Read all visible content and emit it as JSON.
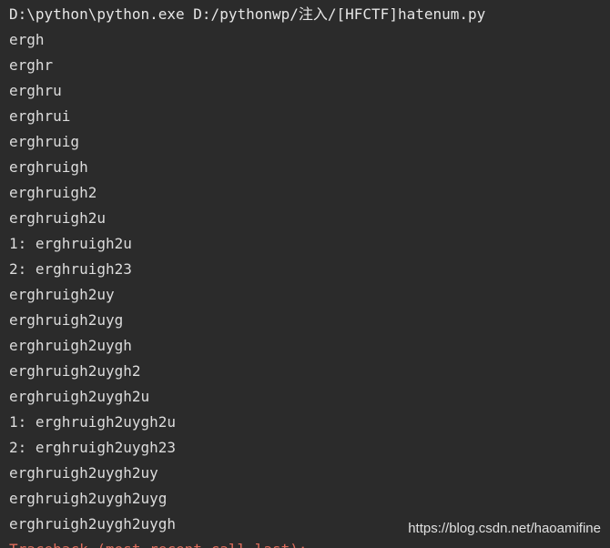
{
  "console": {
    "command_line": "D:\\python\\python.exe D:/pythonwp/注入/[HFCTF]hatenum.py",
    "output_lines": [
      "ergh",
      "erghr",
      "erghru",
      "erghrui",
      "erghruig",
      "erghruigh",
      "erghruigh2",
      "erghruigh2u",
      "1: erghruigh2u",
      "2: erghruigh23",
      "erghruigh2uy",
      "erghruigh2uyg",
      "erghruigh2uygh",
      "erghruigh2uygh2",
      "erghruigh2uygh2u",
      "1: erghruigh2uygh2u",
      "2: erghruigh2uygh23",
      "erghruigh2uygh2uy",
      "erghruigh2uygh2uyg",
      "erghruigh2uygh2uygh"
    ],
    "error_line": "Traceback (most recent call last):"
  },
  "watermark": "https://blog.csdn.net/haoamifine",
  "colors": {
    "background": "#2b2b2b",
    "text": "#dcdcdc",
    "error": "#e06c5b"
  }
}
